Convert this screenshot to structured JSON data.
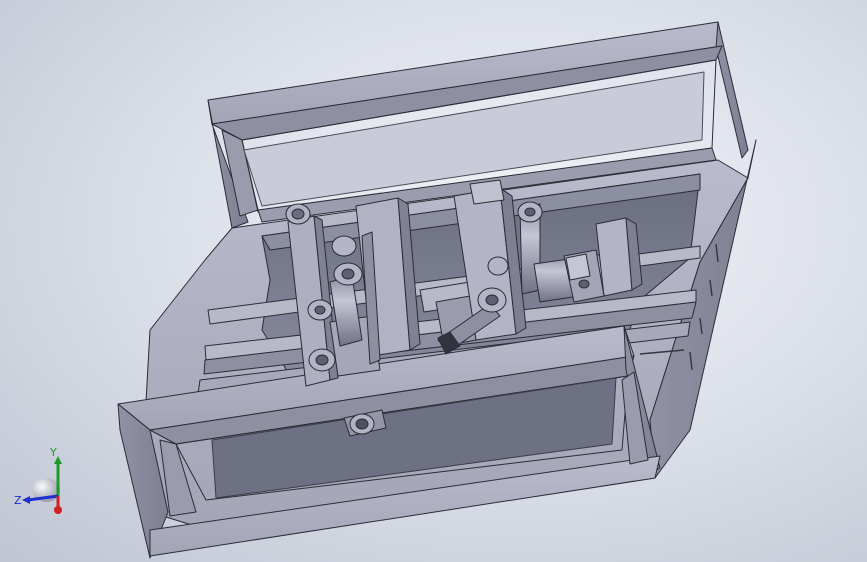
{
  "viewport": {
    "background": "#d6dae3",
    "part_color": "#a4a6b8",
    "edge_color": "#2a2c36"
  },
  "triad": {
    "x_label": "",
    "y_label": "Y",
    "z_label": "Z",
    "x_color": "#d11f1f",
    "y_color": "#1d9b2a",
    "z_color": "#1f2fd1"
  }
}
